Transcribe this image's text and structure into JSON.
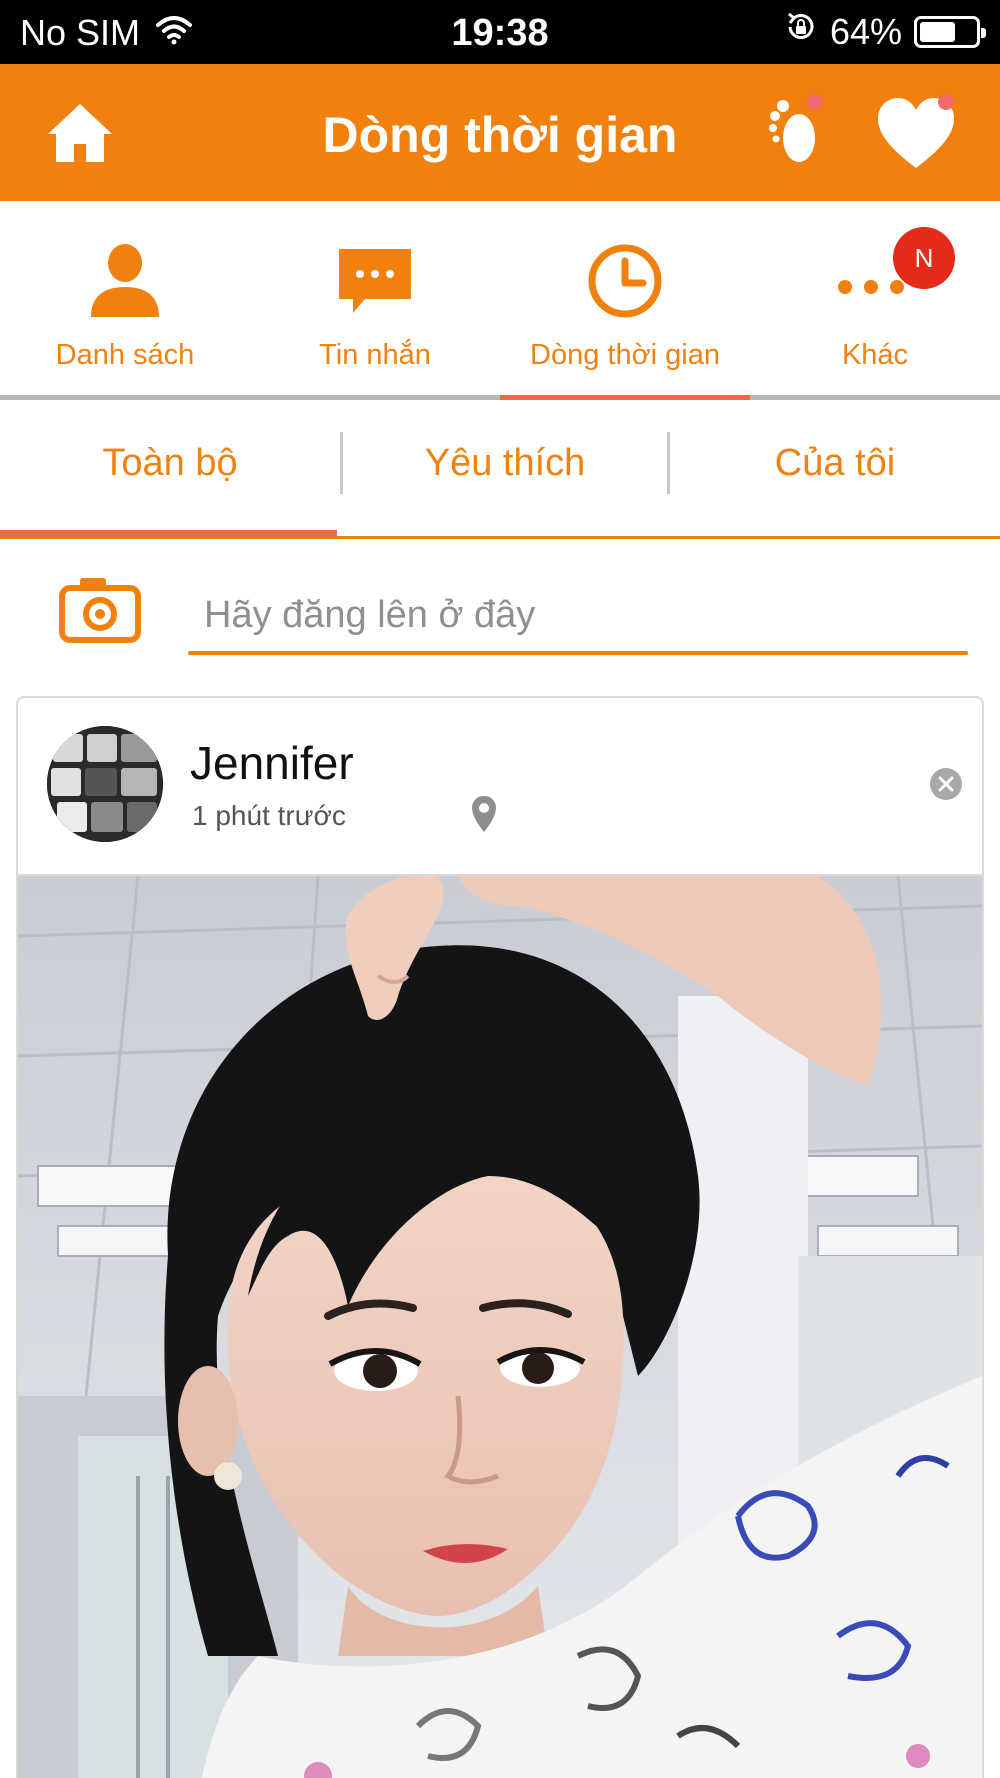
{
  "status_bar": {
    "carrier": "No SIM",
    "time": "19:38",
    "battery_percent": "64%",
    "battery_level": 0.64,
    "icons": [
      "wifi-icon",
      "rotation-lock-icon",
      "battery-icon"
    ]
  },
  "header": {
    "title": "Dòng thời gian",
    "icons": [
      "home-icon",
      "footprints-icon",
      "heart-icon"
    ]
  },
  "main_nav": {
    "items": [
      {
        "label": "Danh sách",
        "icon": "person-icon"
      },
      {
        "label": "Tin nhắn",
        "icon": "chat-bubble-icon"
      },
      {
        "label": "Dòng thời gian",
        "icon": "clock-icon",
        "active": true
      },
      {
        "label": "Khác",
        "icon": "more-icon",
        "badge": "N"
      }
    ]
  },
  "sub_tabs": {
    "items": [
      {
        "label": "Toàn bộ",
        "active": true
      },
      {
        "label": "Yêu thích"
      },
      {
        "label": "Của tôi"
      }
    ]
  },
  "composer": {
    "placeholder": "Hãy đăng lên ở đây",
    "icon": "camera-icon"
  },
  "post": {
    "author": "Jennifer",
    "time": "1 phút trước",
    "icons": [
      "location-pin-icon",
      "close-icon"
    ]
  },
  "colors": {
    "brand_orange": "#F0810E",
    "active_underline": "#F06A4A",
    "badge_red": "#E32B18",
    "notification_dot": "#F26A6A"
  }
}
